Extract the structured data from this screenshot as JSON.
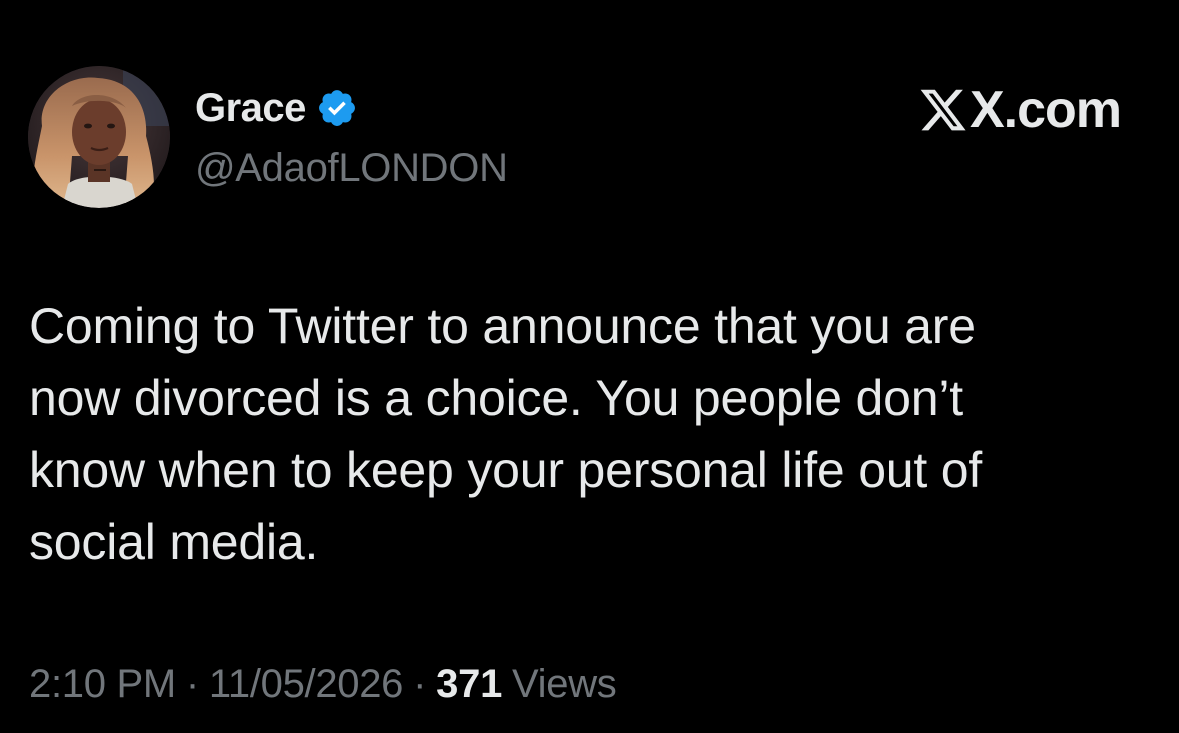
{
  "author": {
    "display_name": "Grace",
    "handle": "@AdaofLONDON",
    "verified": true
  },
  "brand": {
    "text": "X.com"
  },
  "tweet": {
    "text": "Coming to Twitter to announce that you are\nnow divorced is a choice. You people don’t\nknow when to keep your personal life out of\nsocial media."
  },
  "meta": {
    "time": "2:10 PM",
    "separator": "·",
    "date": "11/05/2026",
    "views_count": "371",
    "views_label": "Views"
  },
  "icons": {
    "avatar": "avatar-image",
    "verified": "verified-badge-icon",
    "logo": "x-logo-icon"
  },
  "colors": {
    "background": "#000000",
    "primary_text": "#e7e9ea",
    "secondary_text": "#71767b",
    "verified_blue": "#1d9bf0"
  }
}
